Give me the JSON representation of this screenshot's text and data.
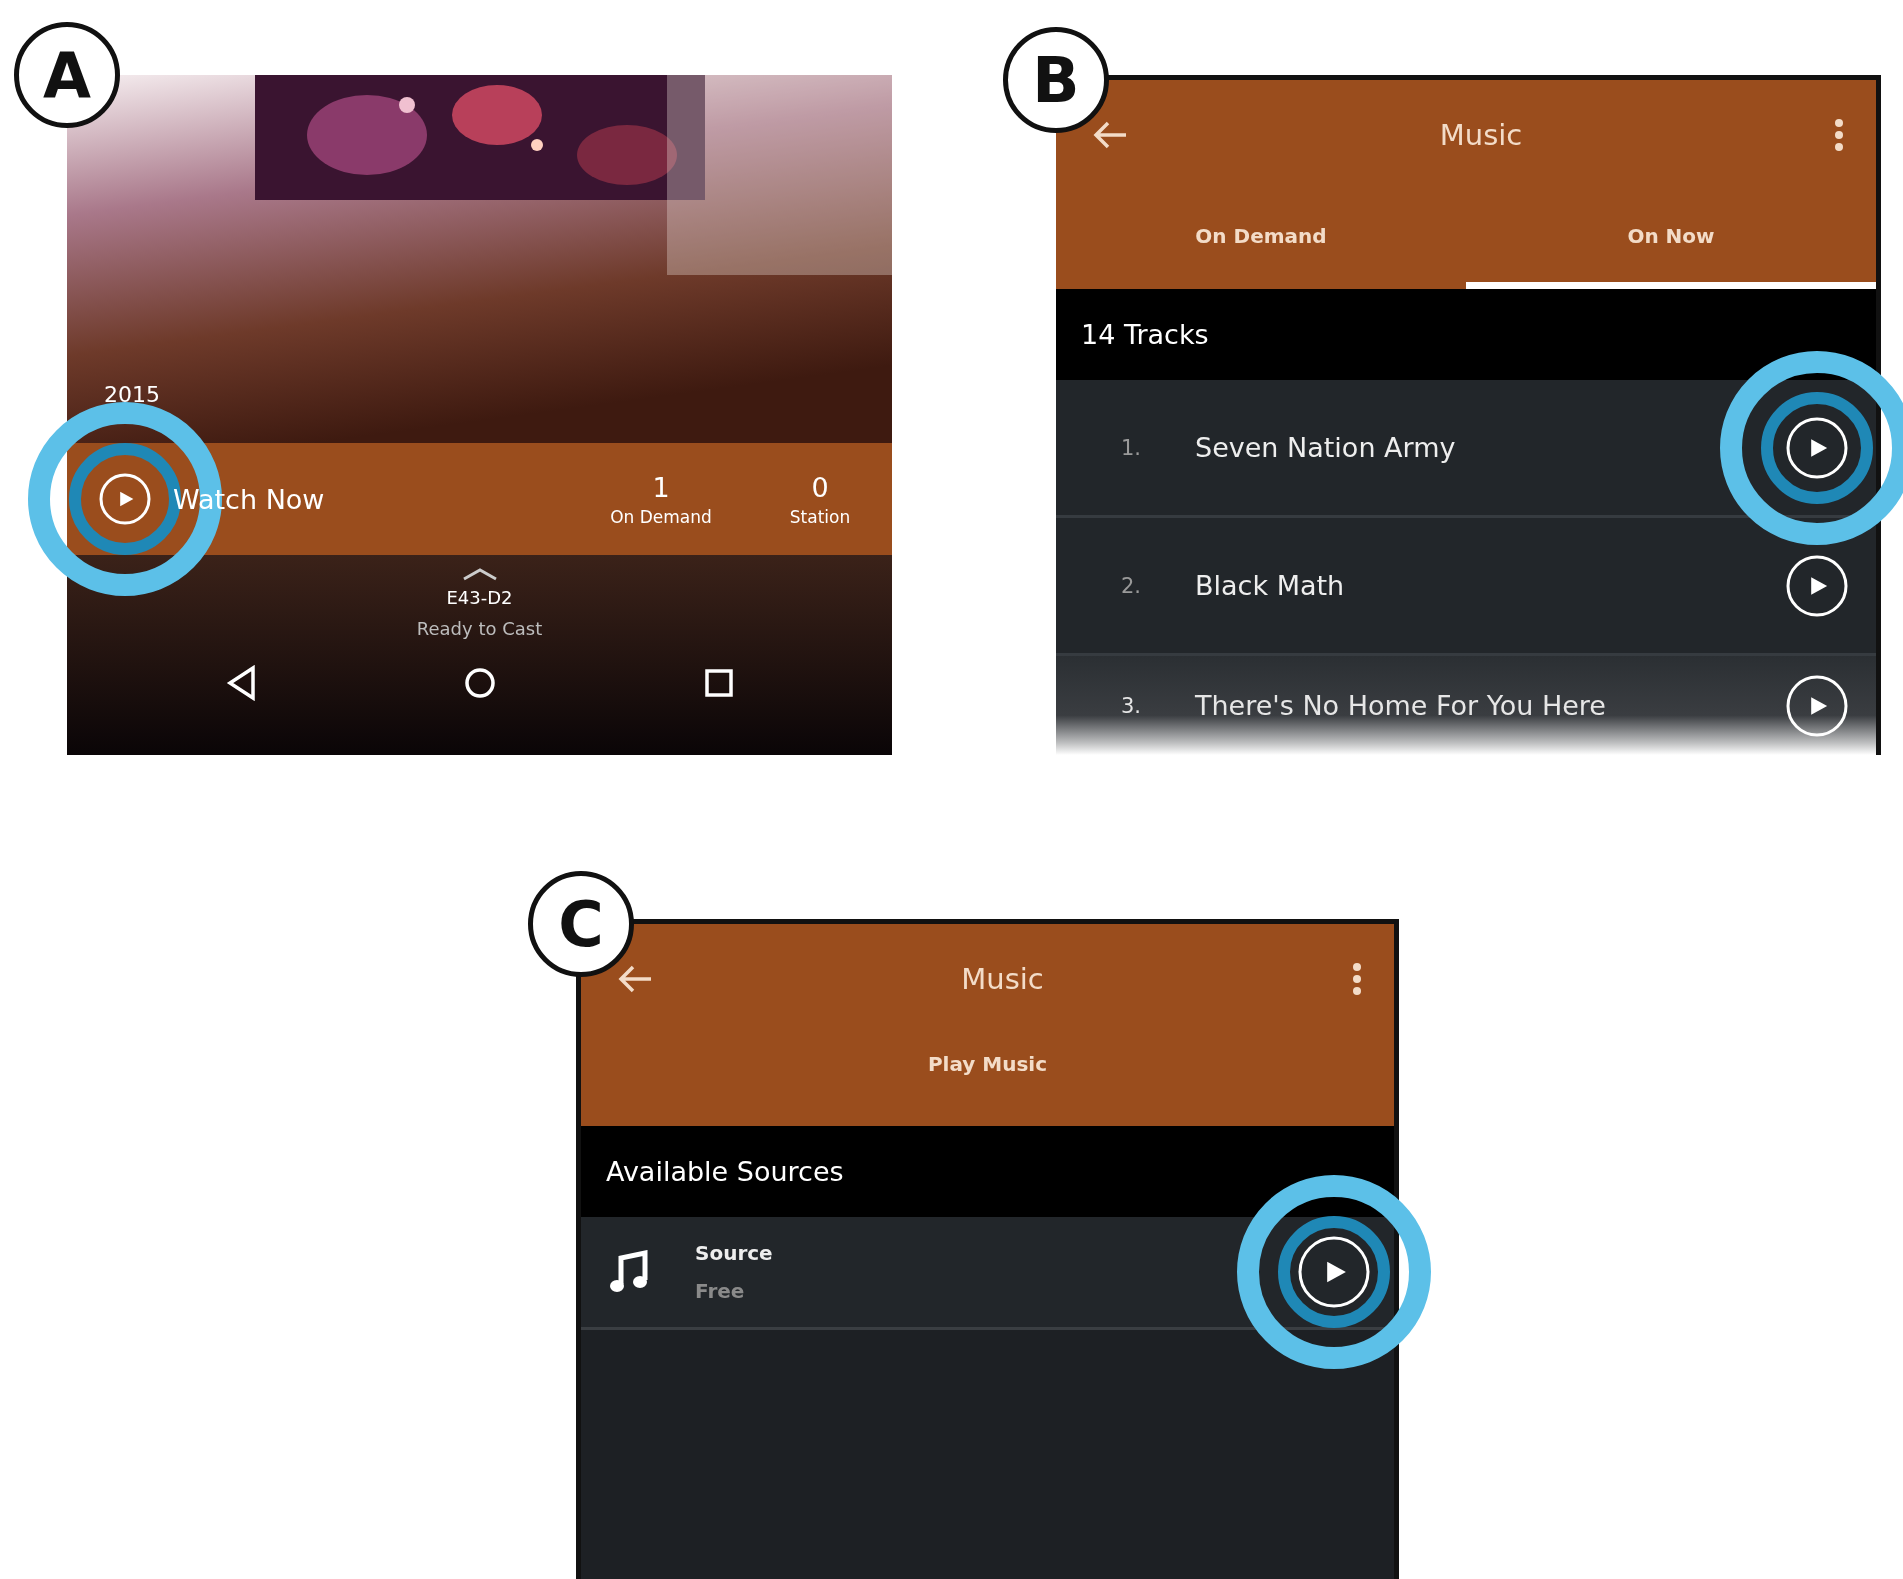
{
  "panel_a": {
    "label": "A",
    "year": "2015",
    "action": {
      "label": "Watch Now",
      "highlighted": true
    },
    "counts": [
      {
        "value": "1",
        "label": "On Demand"
      },
      {
        "value": "0",
        "label": "Station"
      }
    ],
    "device": "E43-D2",
    "device_status": "Ready to Cast"
  },
  "panel_b": {
    "label": "B",
    "title": "Music",
    "tabs": [
      {
        "label": "On Demand",
        "selected": false
      },
      {
        "label": "On Now",
        "selected": true
      }
    ],
    "section": "14 Tracks",
    "tracks": [
      {
        "number": "1.",
        "title": "Seven Nation Army",
        "highlighted": true
      },
      {
        "number": "2.",
        "title": "Black Math",
        "highlighted": false
      },
      {
        "number": "3.",
        "title": "There's No Home For You Here",
        "highlighted": false
      }
    ]
  },
  "panel_c": {
    "label": "C",
    "title": "Music",
    "subtitle": "Play Music",
    "section": "Available Sources",
    "sources": [
      {
        "name": "Source",
        "price": "Free",
        "highlighted": true
      }
    ]
  }
}
